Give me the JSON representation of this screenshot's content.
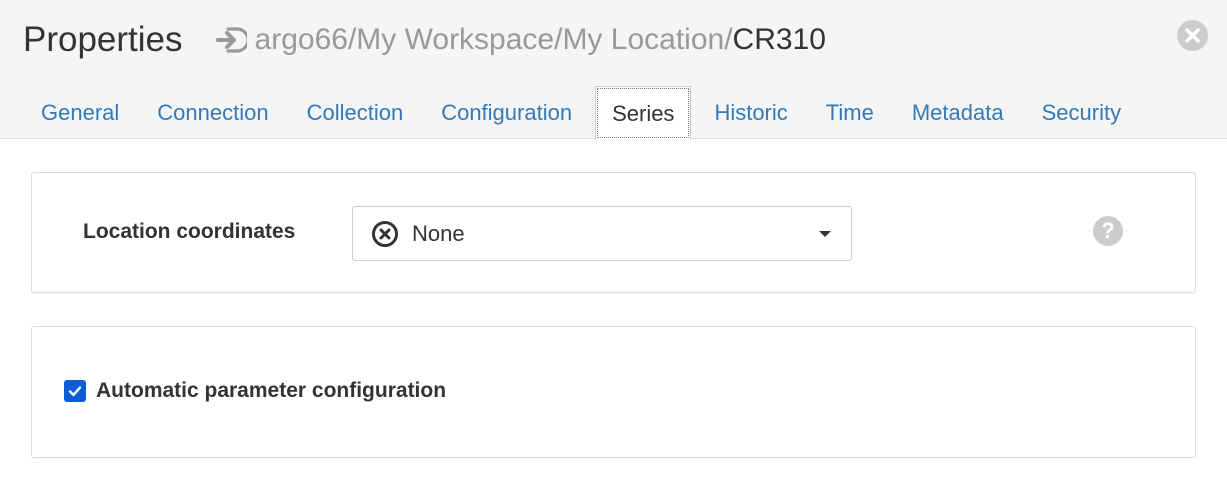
{
  "header": {
    "title": "Properties",
    "path_prefix": "argo66/My Workspace/My Location/",
    "path_current": "CR310",
    "path_icon": "arrow-right-icon",
    "close_icon": "close-icon"
  },
  "tabs": [
    {
      "label": "General",
      "active": false
    },
    {
      "label": "Connection",
      "active": false
    },
    {
      "label": "Collection",
      "active": false
    },
    {
      "label": "Configuration",
      "active": false
    },
    {
      "label": "Series",
      "active": true
    },
    {
      "label": "Historic",
      "active": false
    },
    {
      "label": "Time",
      "active": false
    },
    {
      "label": "Metadata",
      "active": false
    },
    {
      "label": "Security",
      "active": false
    }
  ],
  "location": {
    "label": "Location coordinates",
    "selected_value": "None",
    "selected_icon": "circle-x-icon",
    "help_icon": "question-circle-icon"
  },
  "auto_config": {
    "label": "Automatic parameter configuration",
    "checked": true
  },
  "colors": {
    "accent": "#337ab7",
    "checkbox": "#0b5ed7",
    "header_bg": "#f5f5f5"
  }
}
